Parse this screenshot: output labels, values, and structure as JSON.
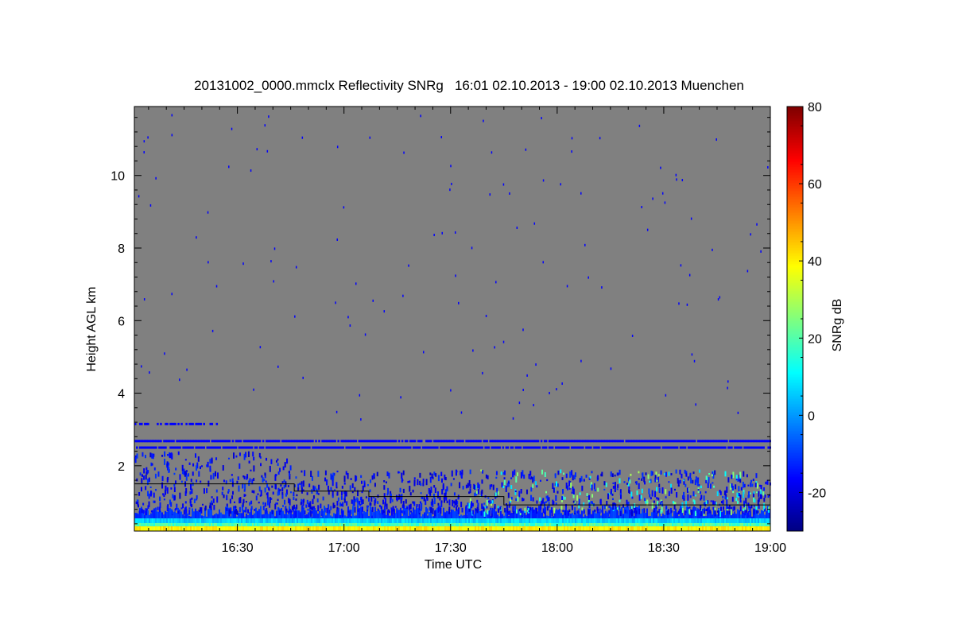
{
  "chart_data": {
    "type": "heatmap",
    "title": "20131002_0000.mmclx Reflectivity SNRg   16:01 02.10.2013 - 19:00 02.10.2013 Muenchen",
    "xlabel": "Time UTC",
    "ylabel": "Height AGL km",
    "colorbar_label": "SNRg dB",
    "x_range": [
      "16:01",
      "19:00"
    ],
    "x_ticks": [
      "16:30",
      "17:00",
      "17:30",
      "18:00",
      "18:30",
      "19:00"
    ],
    "x_tick_minutes": [
      30,
      60,
      90,
      120,
      150,
      180
    ],
    "y_range": [
      0.2,
      11.9
    ],
    "y_ticks": [
      2,
      4,
      6,
      8,
      10
    ],
    "colorbar_range": [
      -30,
      80
    ],
    "colorbar_ticks": [
      -20,
      0,
      20,
      40,
      60,
      80
    ],
    "background_color": "#808080",
    "colormap": [
      "#00007f",
      "#0000ff",
      "#007fff",
      "#00ffff",
      "#7fff7f",
      "#ffff00",
      "#ff7f00",
      "#ff0000",
      "#7f0000"
    ],
    "bright_band_layer_km": [
      0.2,
      0.75
    ],
    "noise_lines_km": [
      3.15,
      2.68,
      2.5
    ],
    "boundary_layer_line": [
      {
        "start_min": 1,
        "end_min": 46,
        "height_km": 1.5
      },
      {
        "start_min": 46,
        "end_min": 67,
        "height_km": 1.3
      },
      {
        "start_min": 67,
        "end_min": 105,
        "height_km": 1.15
      },
      {
        "start_min": 105,
        "end_min": 180,
        "height_km": 0.92
      }
    ]
  }
}
